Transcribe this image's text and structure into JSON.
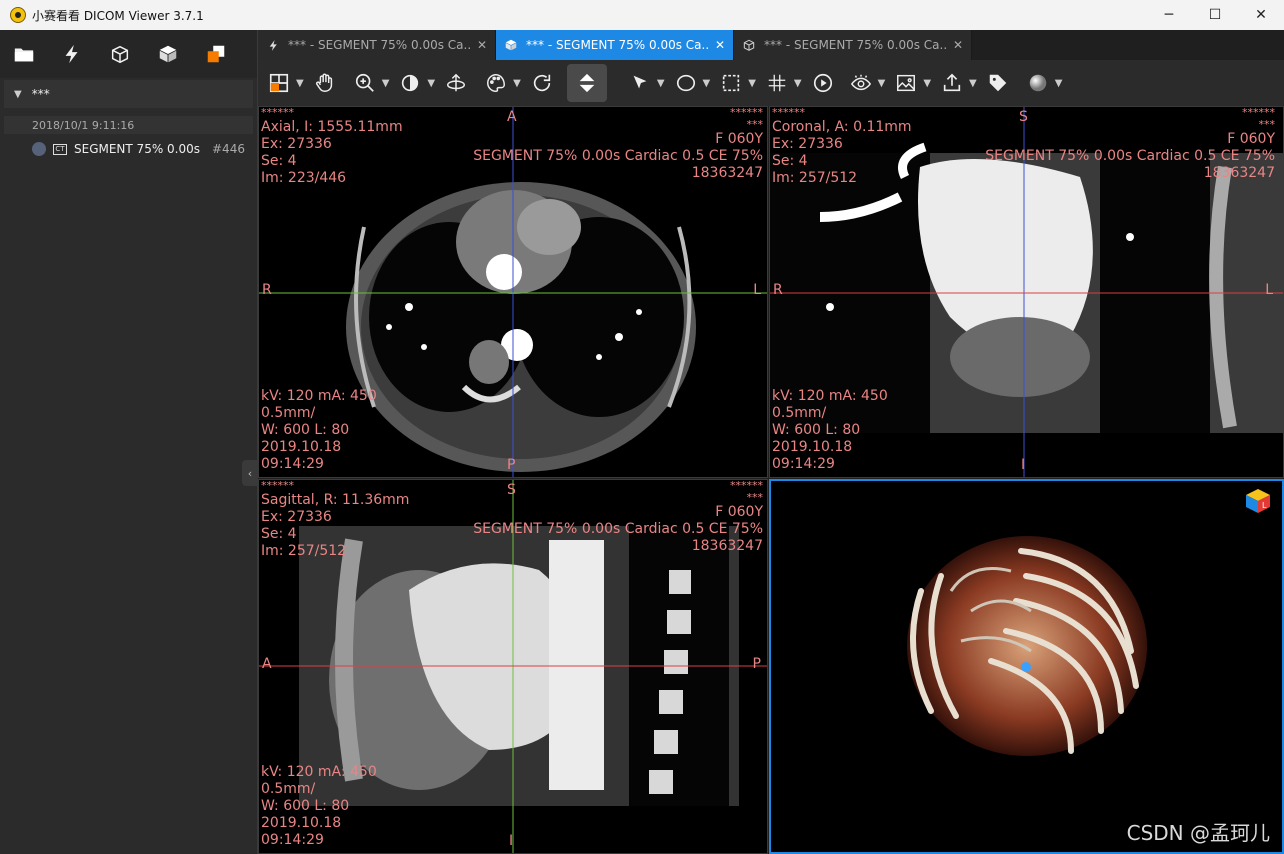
{
  "window": {
    "title": "小赛看看 DICOM Viewer 3.7.1",
    "controls": [
      "─",
      "☐",
      "✕"
    ]
  },
  "sidebar": {
    "tools": [
      "open-folder-icon",
      "lightning-icon",
      "wireframe-cube-icon",
      "solid-cube-icon",
      "layers-icon"
    ],
    "study": {
      "name": "***",
      "date": "2018/10/1 9:11:16"
    },
    "series": {
      "modality": "CT",
      "name": "SEGMENT 75% 0.00s",
      "count": "#446"
    }
  },
  "tabs": [
    {
      "label": "*** - SEGMENT 75% 0.00s Ca...",
      "icon": "lightning-icon",
      "active": false
    },
    {
      "label": "*** - SEGMENT 75% 0.00s Ca...",
      "icon": "cube-icon",
      "active": true
    },
    {
      "label": "*** - SEGMENT 75% 0.00s Ca...",
      "icon": "wireframe-cube-icon",
      "active": false
    }
  ],
  "toolbar": {
    "items": [
      "layout-icon",
      "pan-hand-icon",
      "zoom-icon",
      "contrast-icon",
      "rotate-3d-icon",
      "palette-icon",
      "refresh-icon",
      "scroll-updown-icon",
      "pointer-arrow-icon",
      "ellipse-roi-icon",
      "rect-roi-icon",
      "crosshair-grid-icon",
      "play-icon",
      "eye-icon",
      "image-icon",
      "export-icon",
      "tag-icon",
      "sphere-icon"
    ]
  },
  "viewports": {
    "axial": {
      "mask_tl": "******",
      "title": "Axial, I: 1555.11mm",
      "ex": "Ex: 27336",
      "se": "Se: 4",
      "im": "Im: 223/446",
      "mask_tr1": "******",
      "mask_tr2": "***",
      "sex_age": "F 060Y",
      "desc": "SEGMENT 75% 0.00s Cardiac 0.5 CE 75%",
      "id": "18363247",
      "kv": "kV: 120 mA: 450",
      "thick": "0.5mm/",
      "wl": "W: 600 L: 80",
      "date": "2019.10.18",
      "time": "09:14:29",
      "top": "A",
      "bottom": "P",
      "left": "R",
      "right": "L"
    },
    "coronal": {
      "mask_tl": "******",
      "title": "Coronal, A: 0.11mm",
      "ex": "Ex: 27336",
      "se": "Se: 4",
      "im": "Im: 257/512",
      "mask_tr1": "******",
      "mask_tr2": "***",
      "sex_age": "F 060Y",
      "desc": "SEGMENT 75% 0.00s Cardiac 0.5 CE 75%",
      "id": "18363247",
      "kv": "kV: 120 mA: 450",
      "thick": "0.5mm/",
      "wl": "W: 600 L: 80",
      "date": "2019.10.18",
      "time": "09:14:29",
      "top": "S",
      "bottom": "I",
      "left": "R",
      "right": "L"
    },
    "sagittal": {
      "mask_tl": "******",
      "title": "Sagittal, R: 11.36mm",
      "ex": "Ex: 27336",
      "se": "Se: 4",
      "im": "Im: 257/512",
      "mask_tr1": "******",
      "mask_tr2": "***",
      "sex_age": "F 060Y",
      "desc": "SEGMENT 75% 0.00s Cardiac 0.5 CE 75%",
      "id": "18363247",
      "kv": "kV: 120 mA: 450",
      "thick": "0.5mm/",
      "wl": "W: 600 L: 80",
      "date": "2019.10.18",
      "time": "09:14:29",
      "top": "S",
      "bottom": "I",
      "left": "A",
      "right": "P"
    },
    "volume": {
      "cube_label": "L"
    }
  },
  "watermark": "CSDN @孟珂儿",
  "colors": {
    "accent": "#1e88e5",
    "overlay_text": "#e98585",
    "crosshair_v": "#3b4fd6",
    "crosshair_h_axial": "#6bbf3a",
    "crosshair_h": "#d94040"
  }
}
